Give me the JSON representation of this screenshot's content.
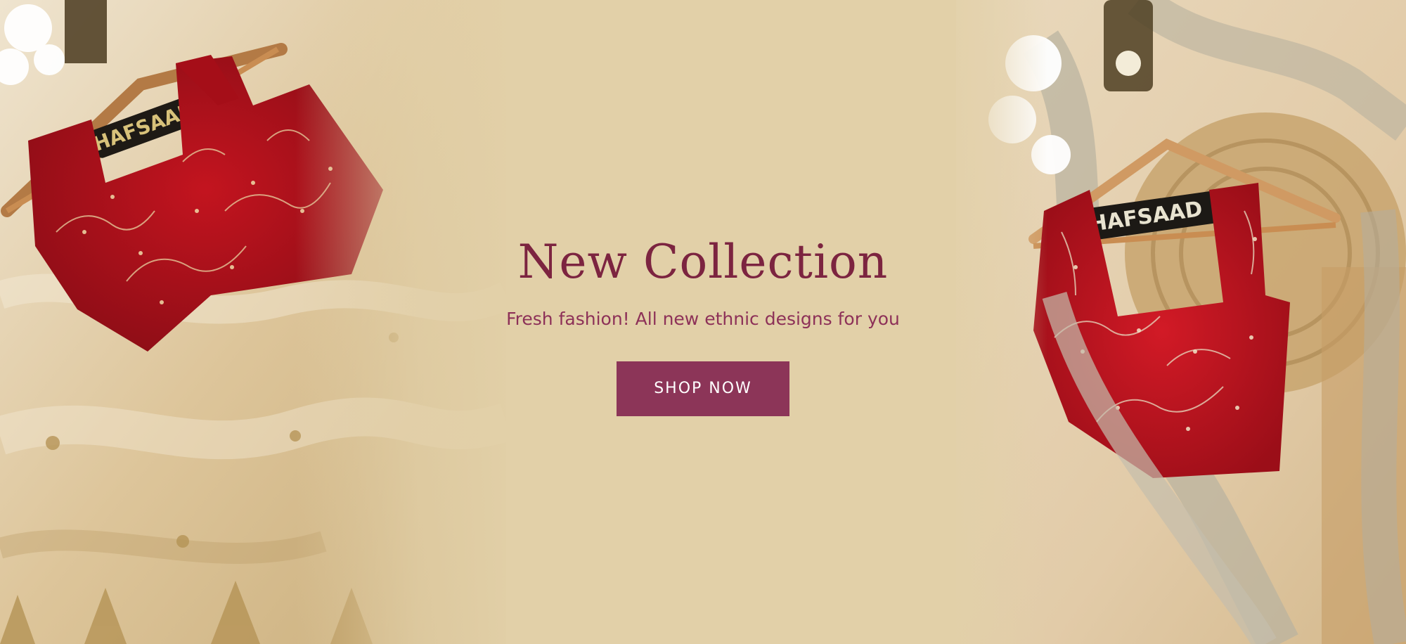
{
  "hero": {
    "title": "New Collection",
    "subtitle": "Fresh fashion! All new ethnic designs for you",
    "cta_label": "SHOP NOW",
    "background_color": "#e2d0a8",
    "title_color": "#7c2440",
    "subtitle_color": "#8d3158",
    "button_color": "#8c3558"
  },
  "photos": {
    "left": {
      "icon": "blouse-on-hanger-photo",
      "hanger_brand": "HAFSAAD",
      "label_small": "HAFSAAD"
    },
    "right": {
      "icon": "blouse-on-hanger-photo",
      "hanger_brand": "HAFSAAD",
      "label_small": "HAFSAAD"
    }
  }
}
